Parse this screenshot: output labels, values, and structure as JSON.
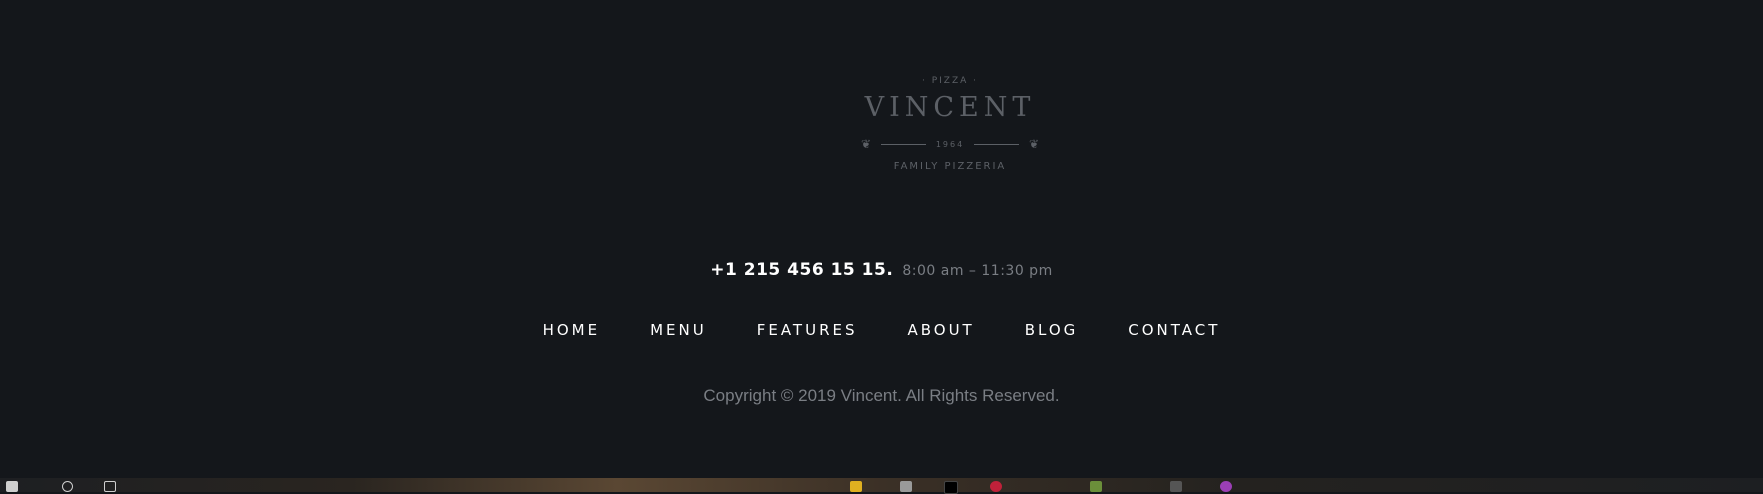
{
  "logo": {
    "top_text": "· PIZZA ·",
    "name": "VINCENT",
    "year": "1964",
    "subtitle": "FAMILY PIZZERIA"
  },
  "contact": {
    "phone": "+1 215 456 15 15.",
    "hours": "8:00 am – 11:30 pm"
  },
  "nav": {
    "items": [
      "HOME",
      "MENU",
      "FEATURES",
      "ABOUT",
      "BLOG",
      "CONTACT"
    ]
  },
  "copyright": "Copyright © 2019 Vincent. All Rights Reserved.",
  "colors": {
    "background": "#14171b",
    "logo": "#5c6066",
    "text_muted": "#7a7e84",
    "text_bright": "#ffffff"
  }
}
